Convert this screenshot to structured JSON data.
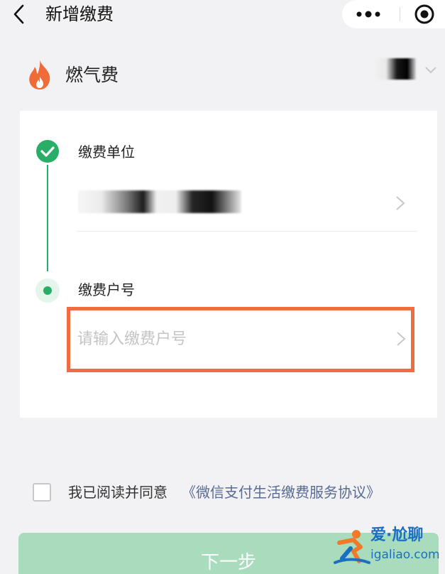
{
  "header": {
    "title": "新增缴费",
    "back_icon": "chevron-left-icon",
    "more_icon": "more-dots-icon",
    "close_icon": "target-circle-icon"
  },
  "bill_type": {
    "name": "燃气费",
    "icon": "flame-icon",
    "icon_color": "#ef6b3a",
    "region_chevron_icon": "chevron-down-icon"
  },
  "form": {
    "steps": [
      {
        "label": "缴费单位",
        "status": "done"
      },
      {
        "label": "缴费户号",
        "status": "current"
      }
    ],
    "account_field": {
      "value": "",
      "placeholder": "请输入缴费户号"
    },
    "accent_color": "#2aae67",
    "highlight_color": "#f06c43"
  },
  "agreement": {
    "text": "我已阅读并同意",
    "link": "《微信支付生活缴费服务协议》",
    "checked": false
  },
  "next_button": {
    "label": "下一步"
  },
  "watermark": {
    "title": "爱·尬聊",
    "domain": "igaliao.com"
  }
}
